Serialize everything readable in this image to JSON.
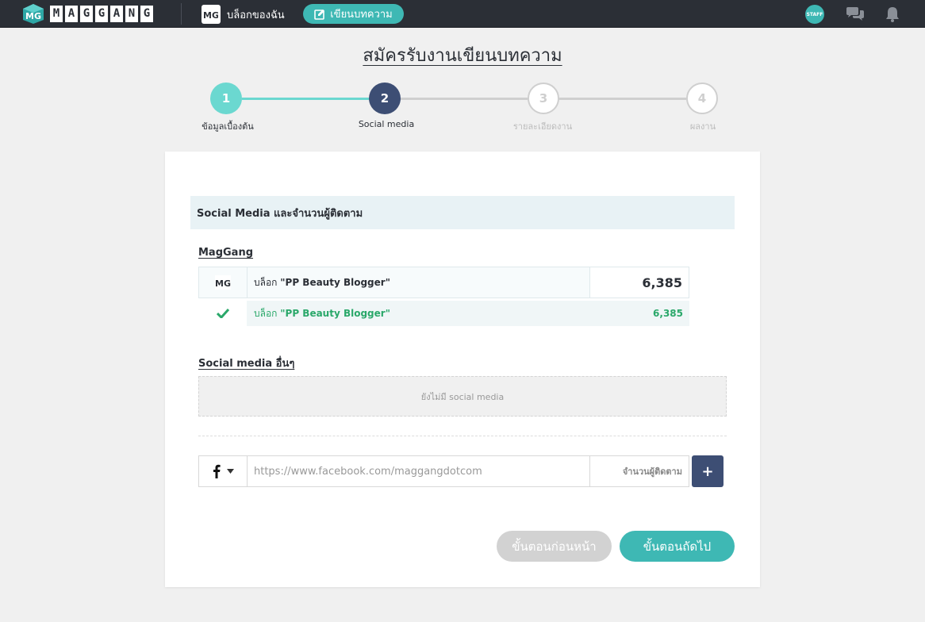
{
  "navbar": {
    "logo_letters": [
      "M",
      "A",
      "G",
      "G",
      "A",
      "N",
      "G"
    ],
    "blog_label": "บล็อกของฉัน",
    "write_label": "เขียนบทความ",
    "staff_badge": "STAFF",
    "icons": [
      "maggang-logo-icon",
      "blog-icon",
      "edit-icon",
      "chat-icon",
      "bell-icon"
    ]
  },
  "page_title": "สมัครรับงานเขียนบทความ",
  "steps": [
    {
      "number": "1",
      "label": "ข้อมูลเบื้องต้น",
      "state": "completed"
    },
    {
      "number": "2",
      "label": "Social media",
      "state": "active"
    },
    {
      "number": "3",
      "label": "รายละเอียดงาน",
      "state": "pending"
    },
    {
      "number": "4",
      "label": "ผลงาน",
      "state": "pending"
    }
  ],
  "colors": {
    "teal": "#3eb8b4",
    "step_completed": "#6bd8d0",
    "step_active": "#3d4e74",
    "step_pending": "#cfcfcf",
    "navbar": "#2b2f36",
    "success_green": "#2aa86a"
  },
  "section_header": "Social Media และจำนวนผู้ติดตาม",
  "maggang": {
    "heading": "MagGang",
    "row": {
      "prefix": "บล็อก",
      "name": "\"PP Beauty Blogger\"",
      "count": "6,385"
    },
    "verified_row": {
      "prefix": "บล็อก",
      "name": "\"PP Beauty Blogger\"",
      "count": "6,385"
    }
  },
  "other": {
    "heading": "Social media อื่นๆ",
    "empty_text": "ยังไม่มี social media"
  },
  "add_form": {
    "platform_icon": "facebook-icon",
    "url_placeholder": "https://www.facebook.com/maggangdotcom",
    "count_placeholder": "จำนวนผู้ติดตาม",
    "add_label": "+"
  },
  "buttons": {
    "prev": "ขั้นตอนก่อนหน้า",
    "next": "ขั้นตอนถัดไป"
  }
}
